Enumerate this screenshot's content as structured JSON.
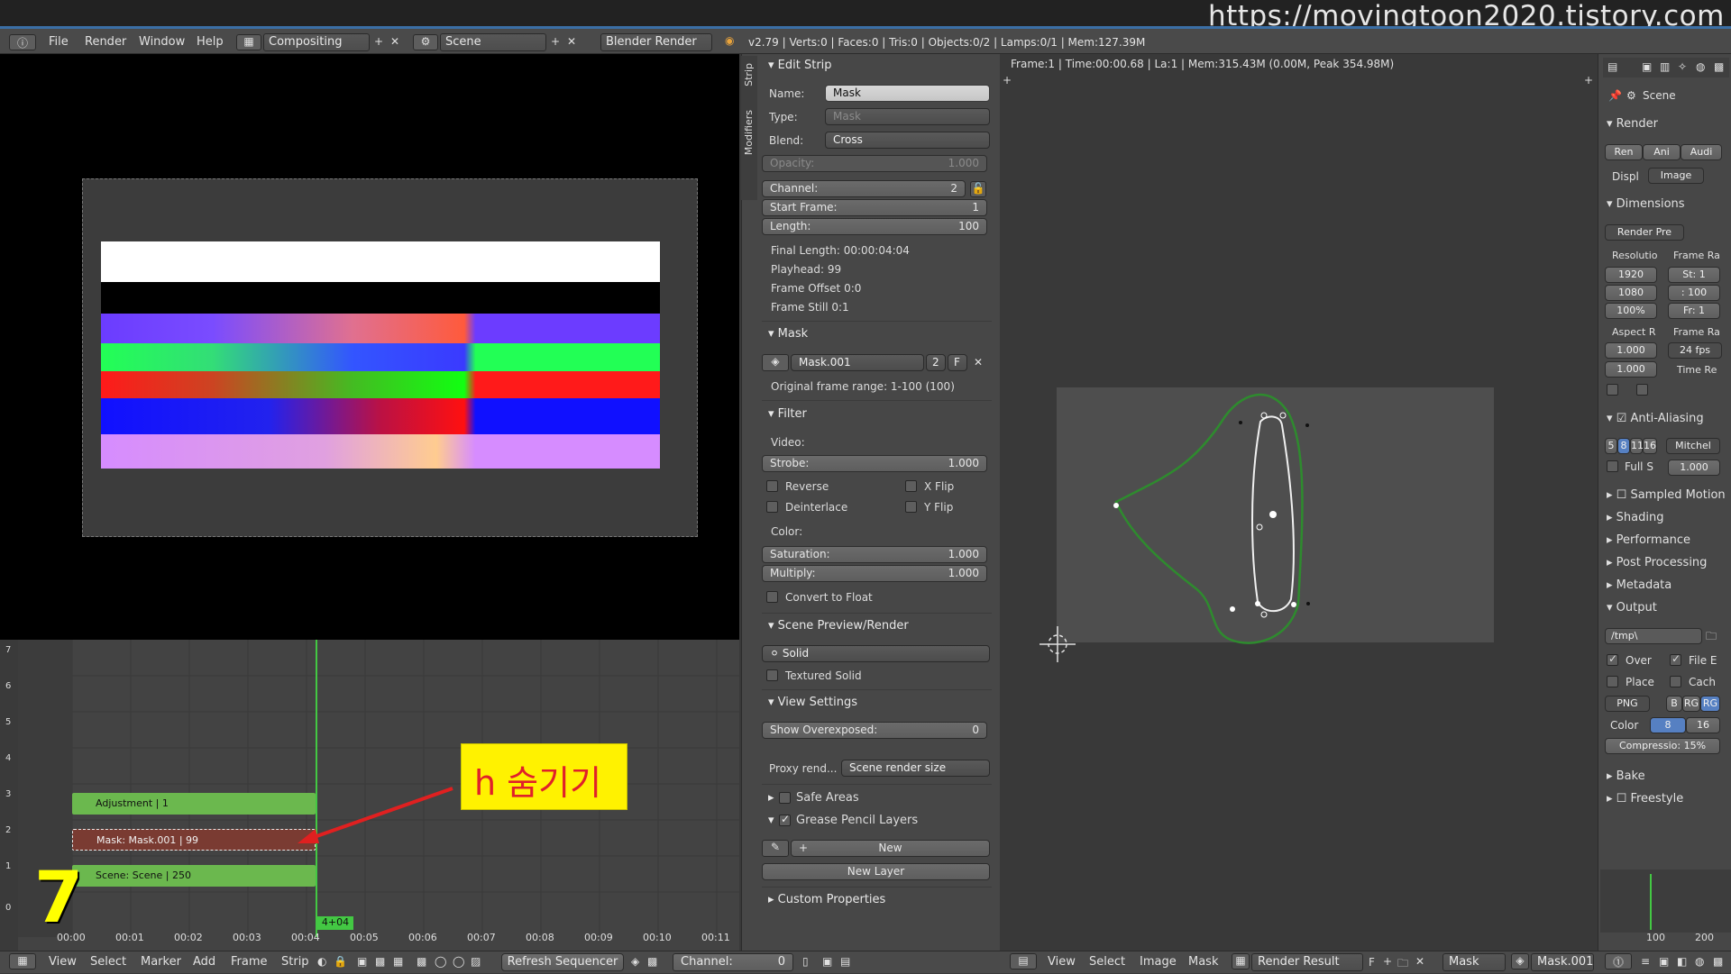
{
  "watermark": "https://movingtoon2020.tistory.com",
  "info_bar": {
    "menus": [
      "File",
      "Render",
      "Window",
      "Help"
    ],
    "screen_layout": "Compositing",
    "scene": "Scene",
    "engine": "Blender Render",
    "stats": "v2.79 | Verts:0 | Faces:0 | Tris:0 | Objects:0/2 | Lamps:0/1 | Mem:127.39M"
  },
  "mask_view_header": "Frame:1 | Time:00:00.68 | La:1 | Mem:315.43M (0.00M, Peak 354.98M)",
  "sequencer": {
    "channels": [
      "7",
      "6",
      "5",
      "4",
      "3",
      "2",
      "1",
      "0"
    ],
    "strips": [
      {
        "label": "Adjustment | 1",
        "color": "#6bb84e"
      },
      {
        "label": "Mask: Mask.001 | 99",
        "color": "#7a3b32"
      },
      {
        "label": "Scene: Scene | 250",
        "color": "#6bb84e"
      }
    ],
    "time_ticks": [
      "00:00",
      "00:01",
      "00:02",
      "00:03",
      "00:04",
      "00:05",
      "00:06",
      "00:07",
      "00:08",
      "00:09",
      "00:10",
      "00:11"
    ],
    "playhead_label": "4+04"
  },
  "side_tabs": [
    "Strip",
    "Modifiers"
  ],
  "edit_strip": {
    "title": "Edit Strip",
    "name_label": "Name:",
    "name_value": "Mask",
    "type_label": "Type:",
    "type_value": "Mask",
    "blend_label": "Blend:",
    "blend_value": "Cross",
    "opacity_label": "Opacity:",
    "opacity_value": "1.000",
    "channel_label": "Channel:",
    "channel_value": "2",
    "start_label": "Start Frame:",
    "start_value": "1",
    "length_label": "Length:",
    "length_value": "100",
    "final_length": "Final Length: 00:00:04:04",
    "playhead": "Playhead: 99",
    "frame_offset": "Frame Offset 0:0",
    "frame_still": "Frame Still 0:1"
  },
  "mask_panel": {
    "title": "Mask",
    "mask_name": "Mask.001",
    "users": "2",
    "fake": "F",
    "range": "Original frame range: 1-100 (100)"
  },
  "filter_panel": {
    "title": "Filter",
    "video": "Video:",
    "strobe_label": "Strobe:",
    "strobe_value": "1.000",
    "reverse": "Reverse",
    "xflip": "X Flip",
    "deinterlace": "Deinterlace",
    "yflip": "Y Flip",
    "color": "Color:",
    "saturation_label": "Saturation:",
    "saturation_value": "1.000",
    "multiply_label": "Multiply:",
    "multiply_value": "1.000",
    "convert": "Convert to Float"
  },
  "scene_preview": {
    "title": "Scene Preview/Render",
    "shading": "Solid",
    "textured": "Textured Solid"
  },
  "view_settings": {
    "title": "View Settings",
    "overexposed_label": "Show Overexposed:",
    "overexposed_value": "0",
    "proxy_label": "Proxy rend...",
    "proxy_value": "Scene render size"
  },
  "safe_areas": "Safe Areas",
  "grease_pencil": {
    "title": "Grease Pencil Layers",
    "new": "New",
    "new_layer": "New Layer"
  },
  "custom_props": "Custom Properties",
  "right_panel": {
    "scene": "Scene",
    "render": "Render",
    "ren": "Ren",
    "ani": "Ani",
    "audi": "Audi",
    "displ": "Displ",
    "image": "Image",
    "dimensions": "Dimensions",
    "render_pre": "Render Pre",
    "resolutio": "Resolutio",
    "frame_ra": "Frame Ra",
    "res_x": "1920",
    "res_y": "1080",
    "res_pct": "100%",
    "start": "St: 1",
    "end": ": 100",
    "step": "Fr: 1",
    "aspect": "Aspect R",
    "frame_rate": "Frame Ra",
    "asp_x": "1.000",
    "asp_y": "1.000",
    "fps": "24 fps",
    "time_re": "Time Re",
    "anti_aliasing": "Anti-Aliasing",
    "aa_5": "5",
    "aa_8": "8",
    "aa_11": "11",
    "aa_16": "16",
    "mitchel": "Mitchel",
    "full_s": "Full S",
    "aa_val": "1.000",
    "sampled_motion": "Sampled Motion",
    "shading": "Shading",
    "performance": "Performance",
    "post_processing": "Post Processing",
    "metadata": "Metadata",
    "output": "Output",
    "path": "/tmp\\",
    "over": "Over",
    "file_e": "File E",
    "place": "Place",
    "cach": "Cach",
    "png": "PNG",
    "bw": "B",
    "rgb": "RG",
    "rgba": "RG",
    "color": "Color",
    "c8": "8",
    "c16": "16",
    "compression": "Compressio: 15%",
    "bake": "Bake",
    "freestyle": "Freestyle",
    "tl_100": "100",
    "tl_200": "200"
  },
  "bottom_bar": {
    "seq_menus": [
      "View",
      "Select",
      "Marker",
      "Add",
      "Frame",
      "Strip"
    ],
    "refresh": "Refresh Sequencer",
    "channel_label": "Channel:",
    "channel_value": "0",
    "img_menus": [
      "View",
      "Select",
      "Image",
      "Mask"
    ],
    "render_result": "Render Result",
    "f": "F",
    "mask_mode": "Mask",
    "mask_name": "Mask.001"
  },
  "callout": "h 숨기기",
  "step_number": "7"
}
